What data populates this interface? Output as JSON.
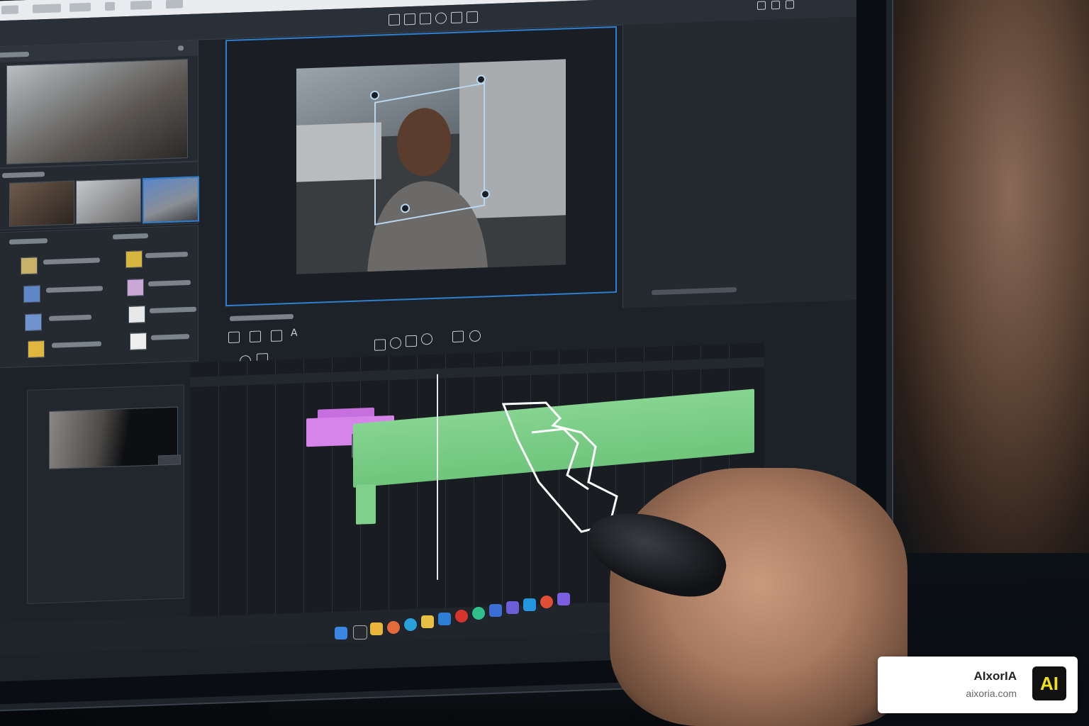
{
  "brand": {
    "name": "AIxorIA",
    "url": "aixoria.com",
    "logo_text": "AI",
    "logo_accent": "#f2e01a"
  },
  "editor": {
    "accent_selection": "#2f7fd0",
    "clip_colors": {
      "title_clip": "#d472e8",
      "video_clip": "#7b8490",
      "audio_clip": "#7fd08a"
    },
    "icons": [
      "menu-icon",
      "settings-icon",
      "close-icon",
      "play-icon",
      "cut-icon",
      "pen-icon",
      "crop-icon",
      "text-icon",
      "search-icon",
      "folder-icon",
      "browser-icon",
      "start-icon"
    ]
  }
}
